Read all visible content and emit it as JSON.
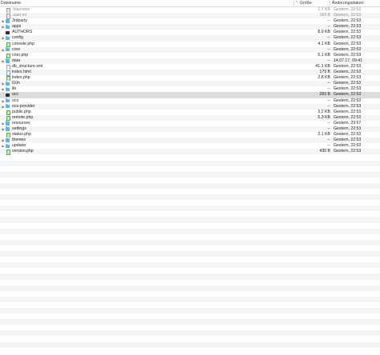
{
  "columns": {
    "name": "Dateiname",
    "size": "Größe",
    "date": "Änderungsdatum",
    "sort_indicator": "^"
  },
  "files": [
    {
      "name": ".htaccess",
      "size": "2,7 KB",
      "date": "Gestern, 22:53",
      "kind": "doc",
      "expandable": false,
      "hidden": true
    },
    {
      "name": ".user.ini",
      "size": "163 B",
      "date": "Gestern, 22:53",
      "kind": "doc",
      "expandable": false,
      "hidden": true
    },
    {
      "name": "3rdparty",
      "size": "--",
      "date": "Gestern, 22:53",
      "kind": "folder",
      "expandable": true,
      "hidden": false
    },
    {
      "name": "apps",
      "size": "--",
      "date": "Gestern, 22:53",
      "kind": "folder",
      "expandable": true,
      "hidden": false
    },
    {
      "name": "AUTHORS",
      "size": "8,9 KB",
      "date": "Gestern, 22:53",
      "kind": "exec",
      "expandable": false,
      "hidden": false
    },
    {
      "name": "config",
      "size": "--",
      "date": "Gestern, 22:53",
      "kind": "folder",
      "expandable": true,
      "hidden": false
    },
    {
      "name": "console.php",
      "size": "4,1 KB",
      "date": "Gestern, 22:53",
      "kind": "php",
      "expandable": false,
      "hidden": false
    },
    {
      "name": "core",
      "size": "--",
      "date": "Gestern, 22:53",
      "kind": "folder",
      "expandable": true,
      "hidden": false
    },
    {
      "name": "cron.php",
      "size": "5,1 KB",
      "date": "Gestern, 22:53",
      "kind": "php",
      "expandable": false,
      "hidden": false
    },
    {
      "name": "data",
      "size": "--",
      "date": "14.07.17, 09:41",
      "kind": "folder",
      "expandable": true,
      "hidden": false
    },
    {
      "name": "db_structure.xml",
      "size": "41,1 KB",
      "date": "Gestern, 22:53",
      "kind": "xml",
      "expandable": false,
      "hidden": false
    },
    {
      "name": "index.html",
      "size": "179 B",
      "date": "Gestern, 22:53",
      "kind": "html",
      "expandable": false,
      "hidden": false
    },
    {
      "name": "index.php",
      "size": "2,8 KB",
      "date": "Gestern, 22:53",
      "kind": "php",
      "expandable": false,
      "hidden": false
    },
    {
      "name": "l10n",
      "size": "--",
      "date": "Gestern, 22:53",
      "kind": "folder",
      "expandable": true,
      "hidden": false
    },
    {
      "name": "lib",
      "size": "--",
      "date": "Gestern, 22:53",
      "kind": "folder",
      "expandable": true,
      "hidden": false
    },
    {
      "name": "occ",
      "size": "283 B",
      "date": "Gestern, 22:53",
      "kind": "exec",
      "expandable": false,
      "hidden": false,
      "selected": true
    },
    {
      "name": "ocs",
      "size": "--",
      "date": "Gestern, 22:53",
      "kind": "folder",
      "expandable": true,
      "hidden": false
    },
    {
      "name": "ocs-provider",
      "size": "--",
      "date": "Gestern, 22:53",
      "kind": "folder",
      "expandable": true,
      "hidden": false
    },
    {
      "name": "public.php",
      "size": "3,2 KB",
      "date": "Gestern, 22:53",
      "kind": "php",
      "expandable": false,
      "hidden": false
    },
    {
      "name": "remote.php",
      "size": "5,3 KB",
      "date": "Gestern, 22:53",
      "kind": "php",
      "expandable": false,
      "hidden": false
    },
    {
      "name": "resources",
      "size": "--",
      "date": "Gestern, 23:57",
      "kind": "folder",
      "expandable": true,
      "hidden": false
    },
    {
      "name": "settings",
      "size": "--",
      "date": "Gestern, 22:53",
      "kind": "folder",
      "expandable": true,
      "hidden": false
    },
    {
      "name": "status.php",
      "size": "2,1 KB",
      "date": "Gestern, 22:53",
      "kind": "php",
      "expandable": false,
      "hidden": false
    },
    {
      "name": "themes",
      "size": "--",
      "date": "Gestern, 22:53",
      "kind": "folder",
      "expandable": true,
      "hidden": false
    },
    {
      "name": "updater",
      "size": "--",
      "date": "Gestern, 22:53",
      "kind": "folder",
      "expandable": true,
      "hidden": false
    },
    {
      "name": "version.php",
      "size": "435 B",
      "date": "Gestern, 22:53",
      "kind": "php",
      "expandable": false,
      "hidden": false
    }
  ],
  "icons": {
    "disclosure": "chevron-right-icon",
    "folder": "folder-icon",
    "document": "document-icon",
    "php": "php-file-icon",
    "html": "html-file-icon",
    "exec": "terminal-executable-icon",
    "xml": "xml-file-icon"
  }
}
